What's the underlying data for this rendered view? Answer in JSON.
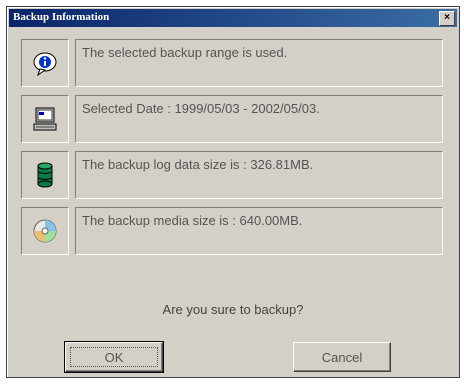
{
  "window": {
    "title": "Backup Information",
    "close_label": "×"
  },
  "rows": [
    {
      "icon": "info-icon",
      "text": "The selected backup range is used."
    },
    {
      "icon": "computer-calendar-icon",
      "text": "Selected Date : 1999/05/03 - 2002/05/03."
    },
    {
      "icon": "database-icon",
      "text": "The backup log data size is : 326.81MB."
    },
    {
      "icon": "cd-disc-icon",
      "text": "The backup media size is : 640.00MB."
    }
  ],
  "question": "Are you sure to backup?",
  "buttons": {
    "ok": "OK",
    "cancel": "Cancel"
  }
}
